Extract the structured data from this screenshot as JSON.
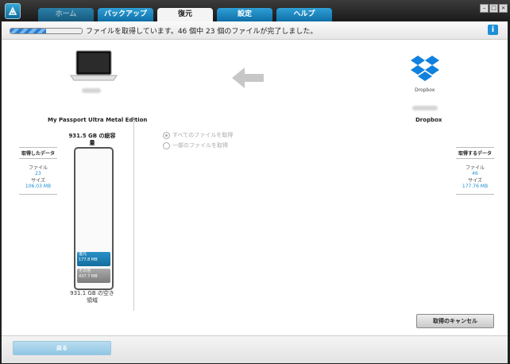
{
  "tabs": [
    {
      "label": "ホーム",
      "state": "disabled"
    },
    {
      "label": "バックアップ",
      "state": "normal"
    },
    {
      "label": "復元",
      "state": "active"
    },
    {
      "label": "設定",
      "state": "normal"
    },
    {
      "label": "ヘルプ",
      "state": "normal"
    }
  ],
  "status": {
    "text": "ファイルを取得しています。46 個中 23 個のファイルが完了しました。",
    "progress": 0.5
  },
  "left_device": {
    "name": "My Passport Ultra Metal Edition",
    "stats": {
      "heading": "取得したデータ",
      "files_label": "ファイル",
      "files_value": "23",
      "size_label": "サイズ",
      "size_value": "106.03 MB"
    }
  },
  "right_device": {
    "logo_label": "Dropbox",
    "name": "Dropbox",
    "stats": {
      "heading": "取得するデータ",
      "files_label": "ファイル",
      "files_value": "46",
      "size_label": "サイズ",
      "size_value": "177.76 MB"
    }
  },
  "capacity": {
    "title": "931.5 GB の総容量",
    "restore_label": "復元",
    "restore_value": "177.8 MB",
    "other_label": "その他",
    "other_value": "437.7 MB",
    "free_label": "931.1 GB の空き領域"
  },
  "options": {
    "all_files": "すべてのファイルを取得",
    "some_files": "一部のファイルを取得"
  },
  "buttons": {
    "cancel": "取得のキャンセル",
    "back": "戻る"
  },
  "colors": {
    "accent": "#1e8fd6",
    "tab_blue": "#1f86c2"
  }
}
